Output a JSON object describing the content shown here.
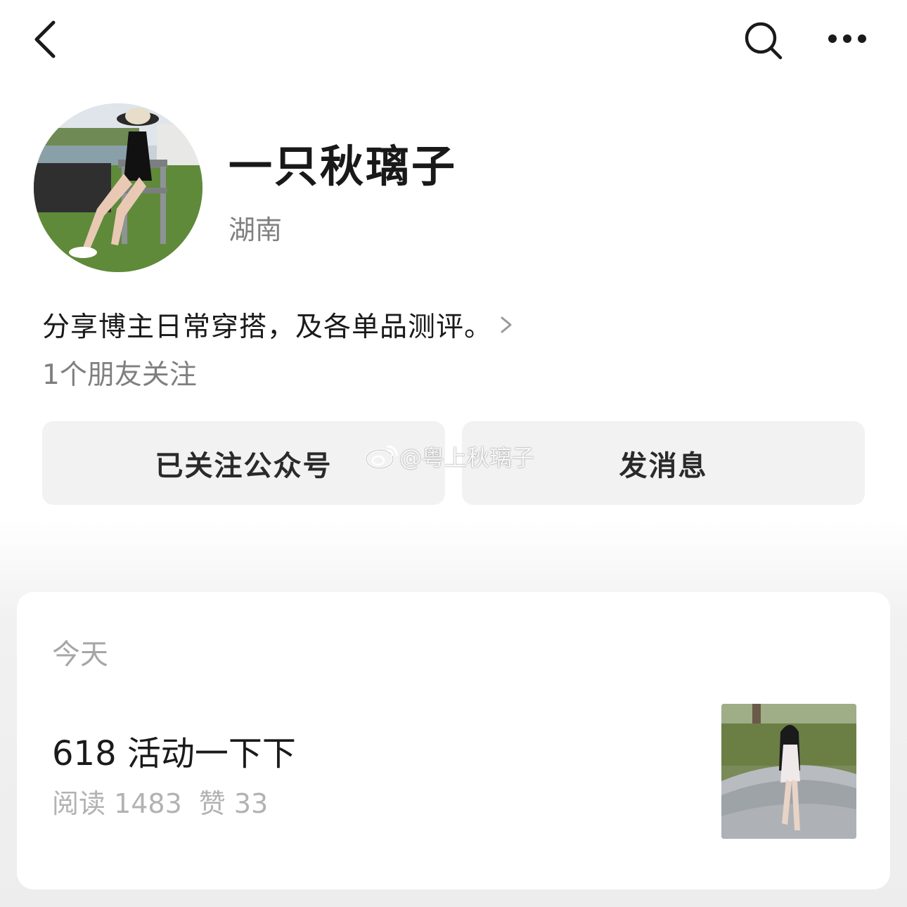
{
  "nav": {
    "back_icon": "chevron-left-icon",
    "search_icon": "search-icon",
    "more_icon": "more-dots-icon"
  },
  "profile": {
    "name": "一只秋璃子",
    "region": "湖南",
    "bio": "分享博主日常穿搭，及各单品测评。",
    "friends_following": "1个朋友关注"
  },
  "actions": {
    "followed_label": "已关注公众号",
    "message_label": "发消息"
  },
  "watermark": {
    "text": "@粤上秋璃子",
    "icon": "weibo-icon"
  },
  "articles": {
    "day_label": "今天",
    "items": [
      {
        "title": "618 活动一下下",
        "reads": "阅读 1483",
        "likes": "赞 33"
      }
    ]
  },
  "colors": {
    "text_primary": "#191919",
    "text_secondary": "#808080",
    "button_bg": "#f2f2f2",
    "page_bg_lower": "#ededed"
  }
}
